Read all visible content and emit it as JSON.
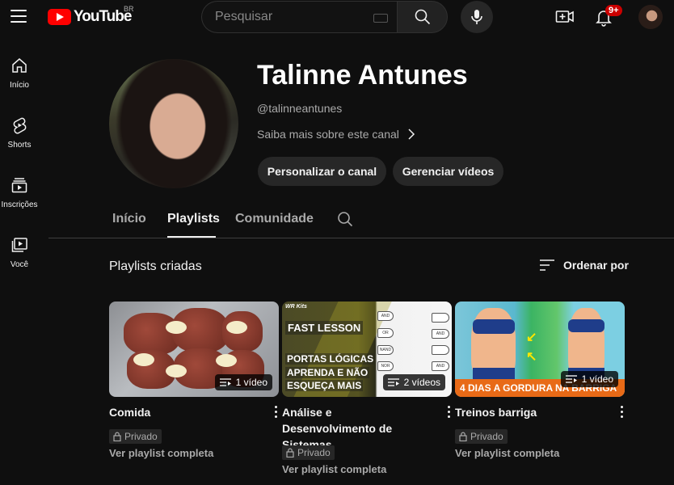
{
  "topbar": {
    "logo_text": "YouTube",
    "region": "BR",
    "search_placeholder": "Pesquisar",
    "notification_count": "9+"
  },
  "sidebar": {
    "items": [
      {
        "label": "Início",
        "icon": "home-icon"
      },
      {
        "label": "Shorts",
        "icon": "shorts-icon"
      },
      {
        "label": "Inscrições",
        "icon": "subscriptions-icon"
      },
      {
        "label": "Você",
        "icon": "you-icon"
      }
    ]
  },
  "channel": {
    "name": "Talinne Antunes",
    "handle": "@talinneantunes",
    "more_link": "Saiba mais sobre este canal",
    "customize_label": "Personalizar o canal",
    "manage_label": "Gerenciar vídeos"
  },
  "tabs": [
    {
      "label": "Início",
      "active": false
    },
    {
      "label": "Playlists",
      "active": true
    },
    {
      "label": "Comunidade",
      "active": false
    }
  ],
  "section": {
    "title": "Playlists criadas",
    "sort_label": "Ordenar por"
  },
  "playlists": [
    {
      "title": "Comida",
      "count": "1 vídeo",
      "privacy": "Privado",
      "link": "Ver playlist completa"
    },
    {
      "title": "Análise e Desenvolvimento de Sistemas",
      "count": "2 vídeos",
      "privacy": "Privado",
      "link": "Ver playlist completa",
      "thumb_text": {
        "brand": "WR Kits",
        "headline": "FAST LESSON",
        "line1": "PORTAS LÓGICAS",
        "line2": "APRENDA E NÃO",
        "line3": "ESQUEÇA MAIS"
      }
    },
    {
      "title": "Treinos barriga",
      "count": "1 vídeo",
      "privacy": "Privado",
      "link": "Ver playlist completa",
      "thumb_text": {
        "banner": "4 DIAS A GORDURA NA BARRIGA"
      }
    }
  ],
  "colors": {
    "background": "#0f0f0f",
    "pill": "#272727",
    "brand_red": "#ff0000",
    "badge_red": "#cc0000"
  }
}
